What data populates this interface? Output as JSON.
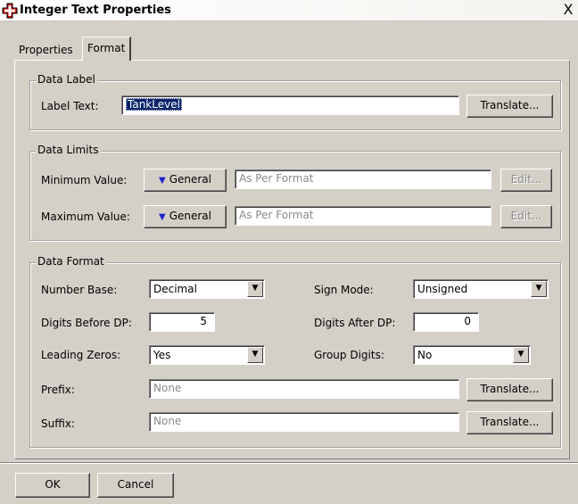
{
  "window": {
    "title": "Integer Text Properties",
    "close_glyph": "X",
    "app_icon": "red-cross-icon",
    "colors": {
      "app_icon": "#cc0000",
      "selection": "#0a246a",
      "dropdown_triangle": "#1e22c8"
    }
  },
  "tabs": [
    {
      "label": "Properties",
      "active": false
    },
    {
      "label": "Format",
      "active": true
    }
  ],
  "data_label": {
    "legend": "Data Label",
    "label_text_label": "Label Text:",
    "label_text_value": "TankLevel",
    "translate_label": "Translate..."
  },
  "data_limits": {
    "legend": "Data Limits",
    "minimum": {
      "label": "Minimum Value:",
      "mode": "General",
      "value": "As Per Format",
      "edit": "Edit..."
    },
    "maximum": {
      "label": "Maximum Value:",
      "mode": "General",
      "value": "As Per Format",
      "edit": "Edit..."
    }
  },
  "data_format": {
    "legend": "Data Format",
    "number_base": {
      "label": "Number Base:",
      "value": "Decimal"
    },
    "sign_mode": {
      "label": "Sign Mode:",
      "value": "Unsigned"
    },
    "digits_before_dp": {
      "label": "Digits Before DP:",
      "value": "5"
    },
    "digits_after_dp": {
      "label": "Digits After DP:",
      "value": "0"
    },
    "leading_zeros": {
      "label": "Leading Zeros:",
      "value": "Yes"
    },
    "group_digits": {
      "label": "Group Digits:",
      "value": "No"
    },
    "prefix": {
      "label": "Prefix:",
      "value": "None",
      "translate": "Translate..."
    },
    "suffix": {
      "label": "Suffix:",
      "value": "None",
      "translate": "Translate..."
    }
  },
  "footer": {
    "ok_label": "OK",
    "cancel_label": "Cancel"
  }
}
